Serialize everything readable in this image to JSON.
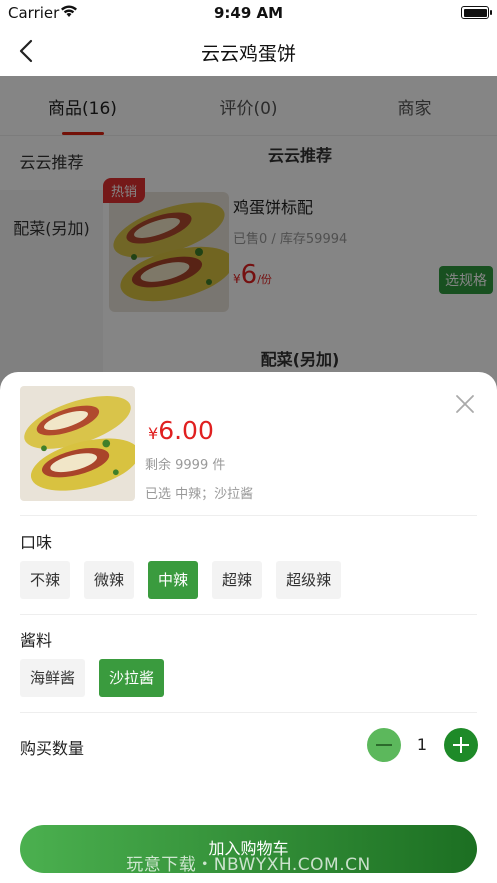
{
  "status_bar": {
    "carrier": "Carrier",
    "time": "9:49 AM"
  },
  "nav": {
    "title": "云云鸡蛋饼"
  },
  "tabs": [
    {
      "label": "商品(16)"
    },
    {
      "label": "评价(0)"
    },
    {
      "label": "商家"
    }
  ],
  "sidebar": {
    "items": [
      {
        "label": "云云推荐"
      },
      {
        "label": "配菜(另加)"
      }
    ]
  },
  "content": {
    "section1_title": "云云推荐",
    "section2_title": "配菜(另加)",
    "product": {
      "badge": "热销",
      "name": "鸡蛋饼标配",
      "stock": "已售0 / 库存59994",
      "price_currency": "¥",
      "price": "6",
      "unit": "/份",
      "spec_button": "选规格"
    }
  },
  "sheet": {
    "price_currency": "¥",
    "price": "6.00",
    "remaining": "剩余 9999 件",
    "selected": "已选 中辣；沙拉酱",
    "groups": [
      {
        "title": "口味",
        "options": [
          {
            "label": "不辣"
          },
          {
            "label": "微辣"
          },
          {
            "label": "中辣"
          },
          {
            "label": "超辣"
          },
          {
            "label": "超级辣"
          }
        ],
        "selected": "中辣"
      },
      {
        "title": "酱料",
        "options": [
          {
            "label": "海鲜酱"
          },
          {
            "label": "沙拉酱"
          }
        ],
        "selected": "沙拉酱"
      }
    ],
    "quantity_label": "购买数量",
    "quantity": "1",
    "add_to_cart": "加入购物车"
  },
  "watermark": "玩意下载・NBWYXH.COM.CN",
  "colors": {
    "accent_green": "#3a9b3e",
    "price_red": "#e02020",
    "hot_red": "#e03030"
  }
}
